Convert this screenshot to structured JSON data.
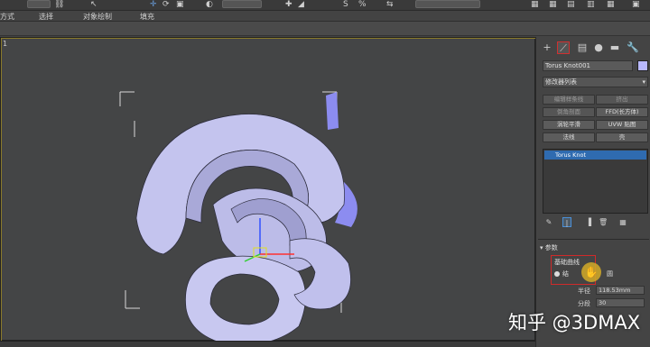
{
  "toolbar": {
    "items": [
      "方式",
      "选择",
      "对象绘制",
      "填充"
    ]
  },
  "viewport": {
    "label": "1"
  },
  "panel": {
    "object_name": "Torus Knot001",
    "object_color": "#b8b8ff",
    "modifier_list_label": "修改器列表",
    "modifier_buttons": [
      {
        "label": "编辑样条线",
        "dim": true
      },
      {
        "label": "挤出",
        "dim": true
      },
      {
        "label": "倒角剖面",
        "dim": true
      },
      {
        "label": "FFD(长方体)",
        "dim": false
      },
      {
        "label": "涡轮平滑",
        "dim": false
      },
      {
        "label": "UVW 贴图",
        "dim": false
      },
      {
        "label": "法线",
        "dim": false
      },
      {
        "label": "壳",
        "dim": false
      }
    ],
    "stack_items": [
      "Torus Knot"
    ],
    "rollout_title": "参数",
    "group_label": "基础曲线",
    "radio_1": "结",
    "radio_2": "圆",
    "params": [
      {
        "label": "半径",
        "value": "118.53mm"
      },
      {
        "label": "分段",
        "value": "30"
      }
    ]
  },
  "watermark": "知乎 @3DMAX",
  "colors": {
    "accent": "#2f6bb0",
    "highlight_box": "#d02a2a",
    "torus": "#c4c4ee"
  }
}
